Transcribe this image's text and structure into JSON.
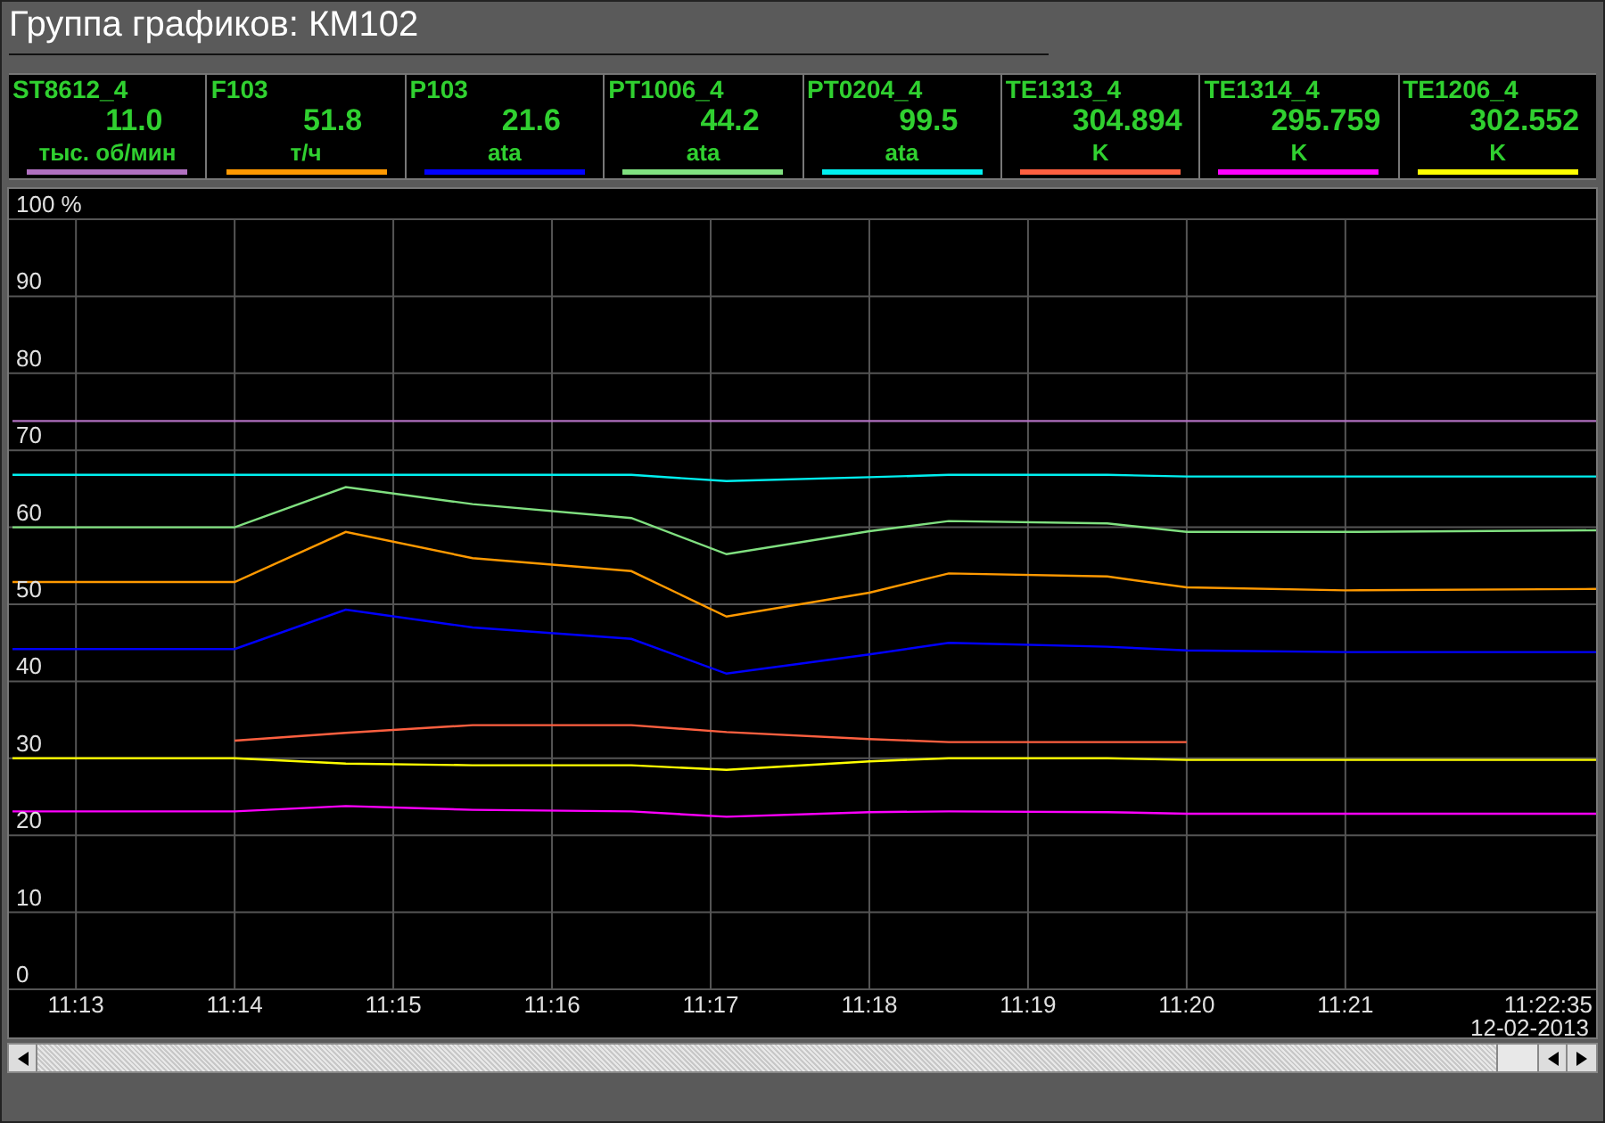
{
  "window": {
    "title": "Группа графиков: КМ102"
  },
  "channels": [
    {
      "name": "ST8612_4",
      "value": "11.0",
      "unit": "тыс. об/мин",
      "color": "#b070c0"
    },
    {
      "name": "F103",
      "value": "51.8",
      "unit": "т/ч",
      "color": "#ff9900"
    },
    {
      "name": "P103",
      "value": "21.6",
      "unit": "ata",
      "color": "#0000ff"
    },
    {
      "name": "PT1006_4",
      "value": "44.2",
      "unit": "ata",
      "color": "#80e080"
    },
    {
      "name": "PT0204_4",
      "value": "99.5",
      "unit": "ata",
      "color": "#00f0f0"
    },
    {
      "name": "TE1313_4",
      "value": "304.894",
      "unit": "K",
      "color": "#ff6040"
    },
    {
      "name": "TE1314_4",
      "value": "295.759",
      "unit": "K",
      "color": "#ff00ff"
    },
    {
      "name": "TE1206_4",
      "value": "302.552",
      "unit": "K",
      "color": "#ffff00"
    }
  ],
  "chart": {
    "date": "12-02-2013",
    "chart_data": {
      "type": "line",
      "grid": true,
      "x": [
        672.6,
        674,
        674.7,
        675.5,
        676.5,
        677.1,
        678,
        678.5,
        679.5,
        680,
        681,
        682.58
      ],
      "xlim": [
        672.6,
        682.58
      ],
      "ylim": [
        0,
        100
      ],
      "xticks": [
        {
          "value": 673,
          "label": "11:13"
        },
        {
          "value": 674,
          "label": "11:14"
        },
        {
          "value": 675,
          "label": "11:15"
        },
        {
          "value": 676,
          "label": "11:16"
        },
        {
          "value": 677,
          "label": "11:17"
        },
        {
          "value": 678,
          "label": "11:18"
        },
        {
          "value": 679,
          "label": "11:19"
        },
        {
          "value": 680,
          "label": "11:20"
        },
        {
          "value": 681,
          "label": "11:21"
        },
        {
          "value": 682.58,
          "label": "11:22:35"
        }
      ],
      "yticks": [
        0,
        10,
        20,
        30,
        40,
        50,
        60,
        70,
        80,
        90,
        {
          "value": 100,
          "label": "100 %"
        }
      ],
      "series": [
        {
          "color": "#b070c0",
          "values": [
            73.8,
            73.8,
            73.8,
            73.8,
            73.8,
            73.8,
            73.8,
            73.8,
            73.8,
            73.8,
            73.8,
            73.8
          ]
        },
        {
          "color": "#ff9900",
          "values": [
            52.9,
            52.9,
            59.4,
            56,
            54.3,
            48.4,
            51.5,
            54,
            53.6,
            52.2,
            51.8,
            52
          ]
        },
        {
          "color": "#0000ff",
          "values": [
            44.2,
            44.2,
            49.3,
            47,
            45.5,
            41,
            43.5,
            45,
            44.5,
            44,
            43.8,
            43.8
          ]
        },
        {
          "color": "#80e080",
          "values": [
            60,
            60,
            65.2,
            63,
            61.2,
            56.5,
            59.5,
            60.8,
            60.5,
            59.4,
            59.4,
            59.6
          ]
        },
        {
          "color": "#00f0f0",
          "values": [
            66.8,
            66.8,
            66.8,
            66.8,
            66.8,
            66,
            66.5,
            66.8,
            66.8,
            66.6,
            66.6,
            66.6
          ]
        },
        {
          "color": "#ff6040",
          "values": [
            null,
            32.3,
            33.3,
            34.3,
            34.3,
            33.4,
            32.5,
            32.1,
            32.1,
            32.1,
            null,
            null
          ]
        },
        {
          "color": "#ff00ff",
          "values": [
            23.1,
            23.1,
            23.8,
            23.3,
            23.1,
            22.4,
            23,
            23.1,
            23,
            22.8,
            22.8,
            22.8
          ]
        },
        {
          "color": "#ffff00",
          "values": [
            30,
            30,
            29.3,
            29.1,
            29.1,
            28.5,
            29.6,
            30,
            30,
            29.8,
            29.8,
            29.8
          ]
        }
      ]
    }
  }
}
